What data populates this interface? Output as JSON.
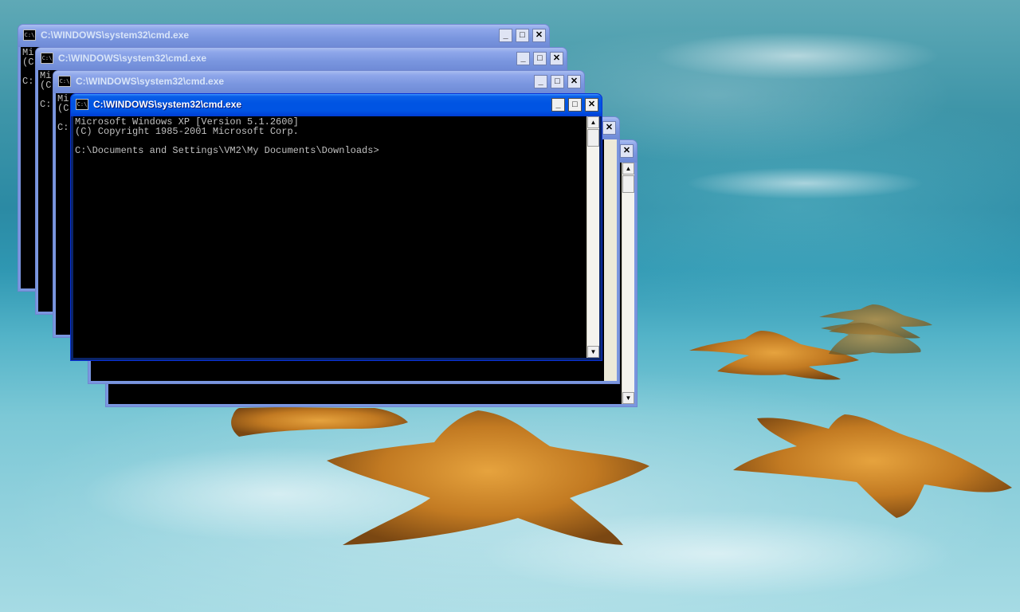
{
  "desktop": {
    "wallpaper": "underwater-starfish-sand",
    "accent": "#0054e3"
  },
  "windows": [
    {
      "title": "C:\\WINDOWS\\system32\\cmd.exe",
      "console_lines": [
        "Mi",
        "(C",
        "",
        "C:"
      ],
      "state": "inactive"
    },
    {
      "title": "C:\\WINDOWS\\system32\\cmd.exe",
      "console_lines": [
        "Mi",
        "(C",
        "",
        "C:"
      ],
      "state": "inactive"
    },
    {
      "title": "C:\\WINDOWS\\system32\\cmd.exe",
      "console_lines": [
        "Mi",
        "(C",
        "",
        "C:"
      ],
      "state": "inactive"
    },
    {
      "title": "",
      "console_lines": [],
      "state": "inactive"
    },
    {
      "title": "",
      "console_lines": [],
      "state": "inactive"
    },
    {
      "title": "C:\\WINDOWS\\system32\\cmd.exe",
      "console_lines": [
        "Microsoft Windows XP [Version 5.1.2600]",
        "(C) Copyright 1985-2001 Microsoft Corp.",
        "",
        "C:\\Documents and Settings\\VM2\\My Documents\\Downloads>"
      ],
      "state": "active"
    }
  ],
  "controls": {
    "minimize": "_",
    "maximize": "□",
    "close": "✕",
    "scroll_up": "▲",
    "scroll_down": "▼",
    "app_icon": "C:\\"
  }
}
